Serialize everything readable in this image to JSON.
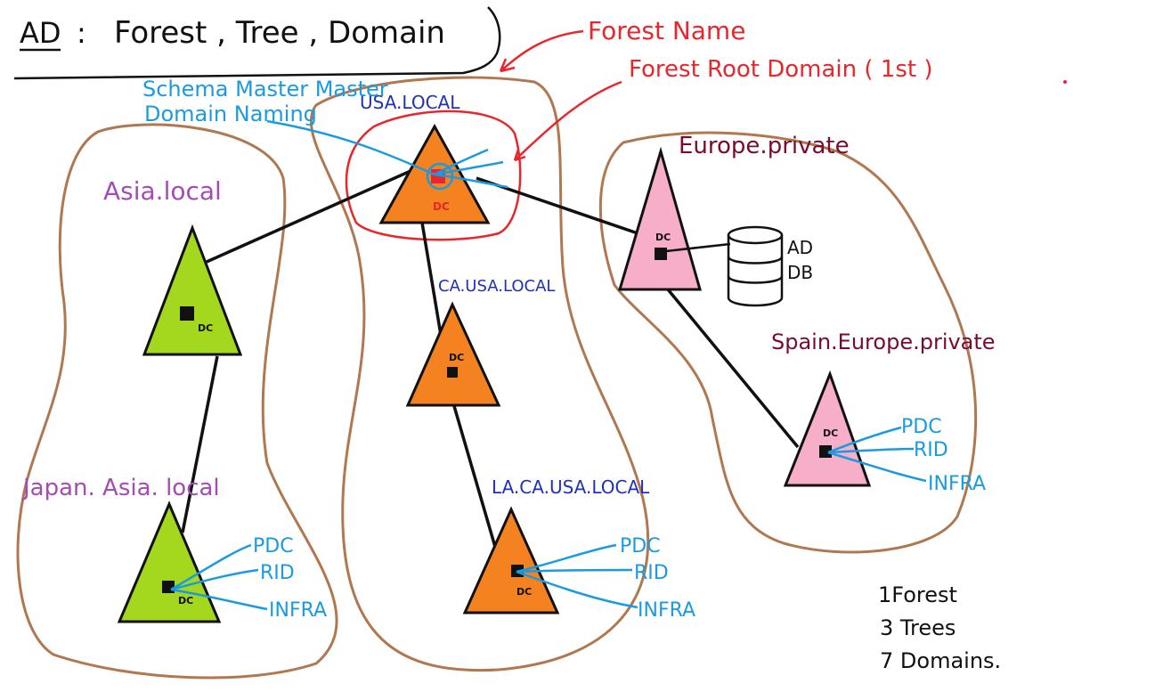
{
  "title": {
    "prefix": "AD",
    "colon": ":",
    "text": "Forest , Tree , Domain"
  },
  "annotations": {
    "forest_name": "Forest Name",
    "forest_root_domain": "Forest Root Domain ( 1st )",
    "roles_root": [
      "Schema Master Master",
      "Domain Naming"
    ]
  },
  "domains": {
    "usa": "USA.LOCAL",
    "ca": "CA.USA.LOCAL",
    "la": "LA.CA.USA.LOCAL",
    "asia": "Asia.local",
    "japan": "Japan. Asia. local",
    "europe": "Europe.private",
    "spain": "Spain.Europe.private"
  },
  "dc_label": "DC",
  "database": [
    "AD",
    "DB"
  ],
  "fsmo_roles": [
    "PDC",
    "RID",
    "INFRA"
  ],
  "summary": [
    "1Forest",
    "3 Trees",
    "7 Domains."
  ],
  "colors": {
    "orange": "#f58220",
    "green": "#a4d81e",
    "pink": "#f7aec8",
    "red": "#e8262b",
    "blue": "#2030b8",
    "cyan": "#1a9be0",
    "purple": "#a44bb4",
    "maroon": "#7a0b2d",
    "forest_outline": "#b07850"
  }
}
